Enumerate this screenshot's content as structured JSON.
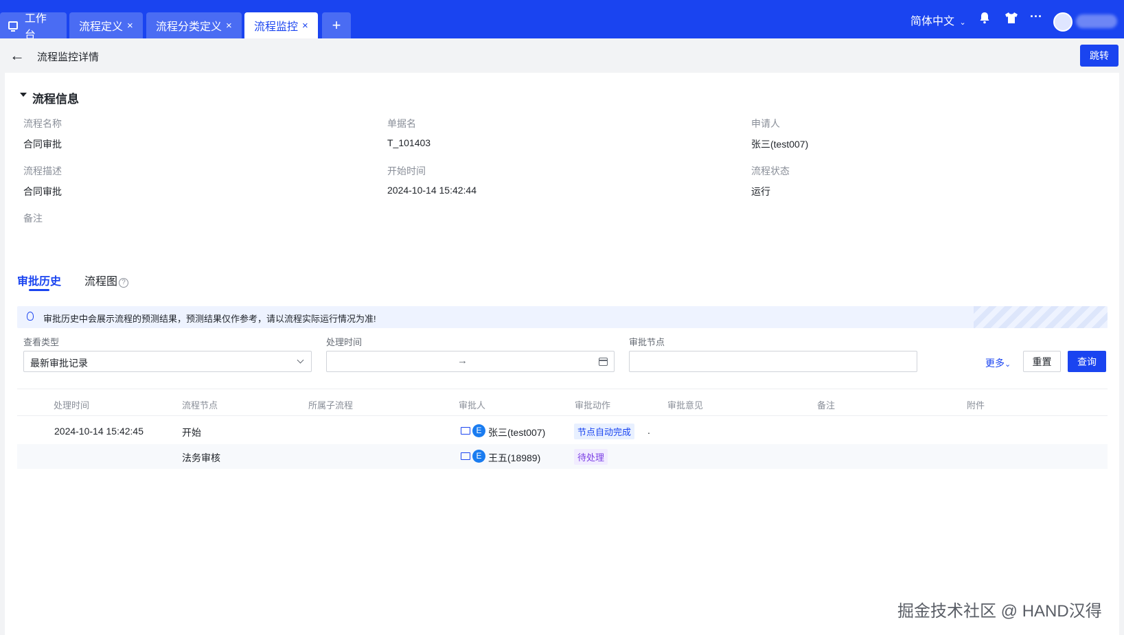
{
  "tabs": [
    {
      "label": "工作台",
      "closable": false,
      "active": false
    },
    {
      "label": "流程定义",
      "closable": true,
      "active": false
    },
    {
      "label": "流程分类定义",
      "closable": true,
      "active": false
    },
    {
      "label": "流程监控",
      "closable": true,
      "active": true
    }
  ],
  "tab_close_symbol": "×",
  "add_tab_symbol": "+",
  "topbar": {
    "language": "简体中文",
    "icons": [
      "bell-icon",
      "shirt-icon",
      "more-icon"
    ]
  },
  "header": {
    "title": "流程监控详情",
    "jump_button": "跳转"
  },
  "process_info": {
    "section_title": "流程信息",
    "fields": {
      "process_name": {
        "label": "流程名称",
        "value": "合同审批"
      },
      "document_name": {
        "label": "单据名",
        "value": "T_101403"
      },
      "applicant": {
        "label": "申请人",
        "value": "张三(test007)"
      },
      "process_desc": {
        "label": "流程描述",
        "value": "合同审批"
      },
      "start_time": {
        "label": "开始时间",
        "value": "2024-10-14 15:42:44"
      },
      "process_status": {
        "label": "流程状态",
        "value": "运行"
      },
      "remark": {
        "label": "备注",
        "value": ""
      }
    }
  },
  "detail_tabs": {
    "history": "审批历史",
    "diagram": "流程图"
  },
  "notice": "审批历史中会展示流程的预测结果，预测结果仅作参考，请以流程实际运行情况为准!",
  "filters": {
    "view_type_label": "查看类型",
    "view_type_value": "最新审批记录",
    "process_time_label": "处理时间",
    "range_separator": "→",
    "approval_node_label": "审批节点",
    "more": "更多",
    "reset": "重置",
    "query": "查询"
  },
  "table": {
    "columns": [
      "处理时间",
      "流程节点",
      "所属子流程",
      "审批人",
      "审批动作",
      "审批意见",
      "备注",
      "附件"
    ],
    "rows": [
      {
        "time": "2024-10-14 15:42:45",
        "node": "开始",
        "sub_process": "",
        "approver_badge": "E",
        "approver": "张三(test007)",
        "action": "节点自动完成",
        "action_color": "#1a44f0",
        "opinion": ".",
        "remark": "",
        "attachment": ""
      },
      {
        "time": "",
        "node": "法务审核",
        "sub_process": "",
        "approver_badge": "E",
        "approver": "王五(18989)",
        "action": "待处理",
        "action_color": "#7b3fe4",
        "opinion": "",
        "remark": "",
        "attachment": ""
      }
    ]
  },
  "watermark": "掘金技术社区 @ HAND汉得"
}
